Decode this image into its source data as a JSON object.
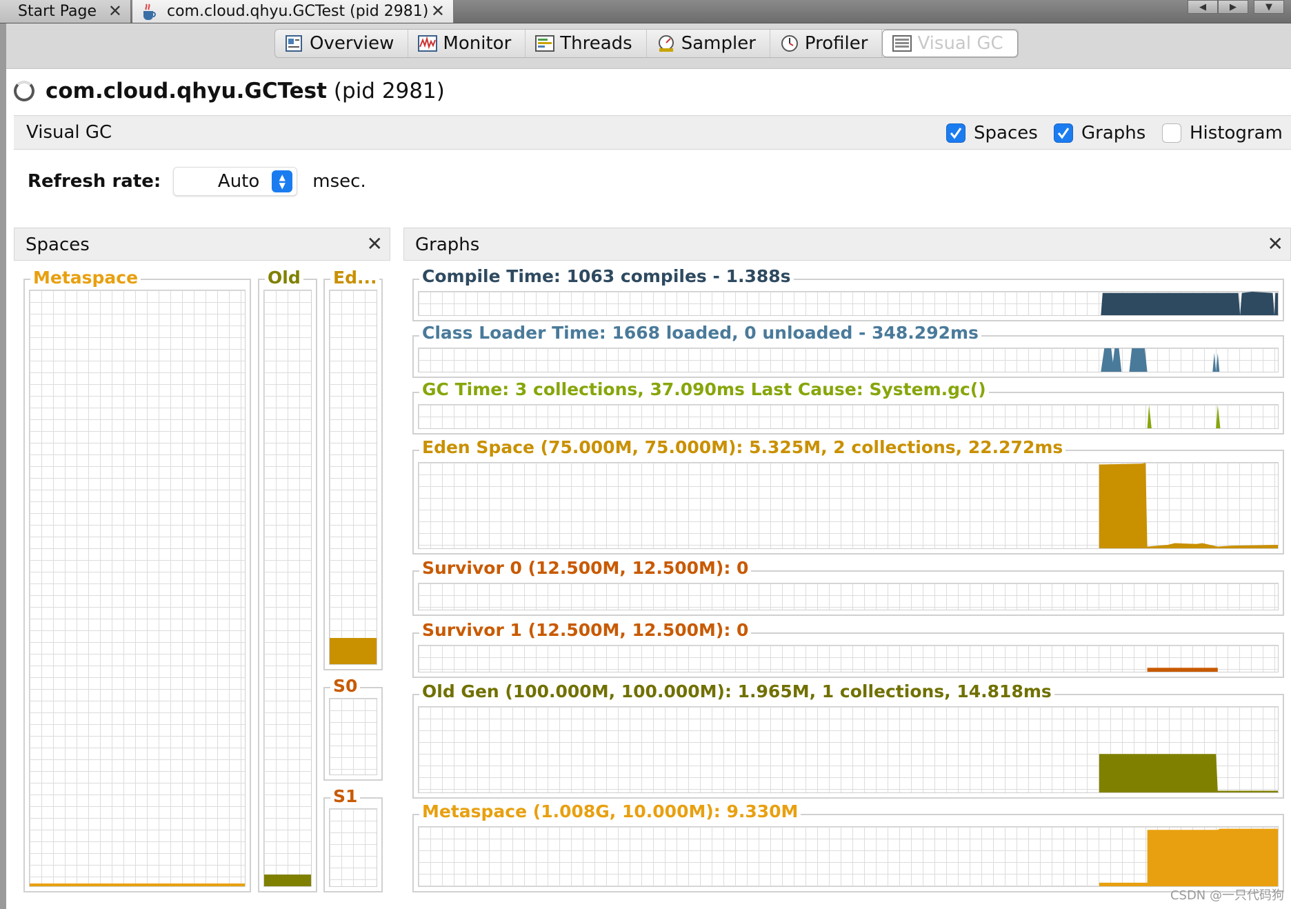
{
  "tabs": {
    "start": {
      "label": "Start Page",
      "close": "✕"
    },
    "app": {
      "label": "com.cloud.qhyu.GCTest (pid 2981)",
      "close": "✕"
    }
  },
  "view_tabs": [
    {
      "label": "Overview",
      "icon": "overview-icon"
    },
    {
      "label": "Monitor",
      "icon": "monitor-icon"
    },
    {
      "label": "Threads",
      "icon": "threads-icon"
    },
    {
      "label": "Sampler",
      "icon": "sampler-icon"
    },
    {
      "label": "Profiler",
      "icon": "profiler-icon"
    },
    {
      "label": "Visual GC",
      "icon": "visual-gc-icon",
      "active": true
    }
  ],
  "header": {
    "process": "com.cloud.qhyu.GCTest",
    "pid": "(pid 2981)"
  },
  "visual_gc": {
    "title": "Visual GC",
    "spaces_checkbox": {
      "label": "Spaces",
      "checked": true
    },
    "graphs_checkbox": {
      "label": "Graphs",
      "checked": true
    },
    "histogram_checkbox": {
      "label": "Histogram",
      "checked": false
    }
  },
  "refresh": {
    "label": "Refresh rate:",
    "value": "Auto",
    "unit": "msec."
  },
  "spaces_panel": {
    "title": "Spaces",
    "close": "✕",
    "metaspace": {
      "label": "Metaspace",
      "fill": 0.004,
      "color": "#e8a010"
    },
    "old": {
      "label": "Old",
      "fill": 0.02,
      "color": "#808000"
    },
    "eden": {
      "label": "Ed...",
      "fill": 0.071,
      "color": "#c99000"
    },
    "s0": {
      "label": "S0",
      "fill": 0,
      "color": "#c85a00"
    },
    "s1": {
      "label": "S1",
      "fill": 0,
      "color": "#c85a00"
    }
  },
  "graphs_panel": {
    "title": "Graphs",
    "close": "✕",
    "compile": {
      "label": "Compile Time: 1063 compiles - 1.388s",
      "color": "#2e4a60"
    },
    "classloader": {
      "label": "Class Loader Time: 1668 loaded, 0 unloaded - 348.292ms",
      "color": "#4a7a9a"
    },
    "gc": {
      "label": "GC Time: 3 collections, 37.090ms Last Cause: System.gc()",
      "color": "#86a60a"
    },
    "eden": {
      "label": "Eden Space (75.000M, 75.000M): 5.325M, 2 collections, 22.272ms",
      "color": "#c99000"
    },
    "survivor0": {
      "label": "Survivor 0 (12.500M, 12.500M): 0",
      "color": "#c85a00"
    },
    "survivor1": {
      "label": "Survivor 1 (12.500M, 12.500M): 0",
      "color": "#c85a00"
    },
    "oldgen": {
      "label": "Old Gen (100.000M, 100.000M): 1.965M, 1 collections, 14.818ms",
      "color": "#707000"
    },
    "metaspace": {
      "label": "Metaspace (1.008G, 10.000M): 9.330M",
      "color": "#e8a010"
    }
  },
  "watermark": "CSDN @一只代码狗"
}
